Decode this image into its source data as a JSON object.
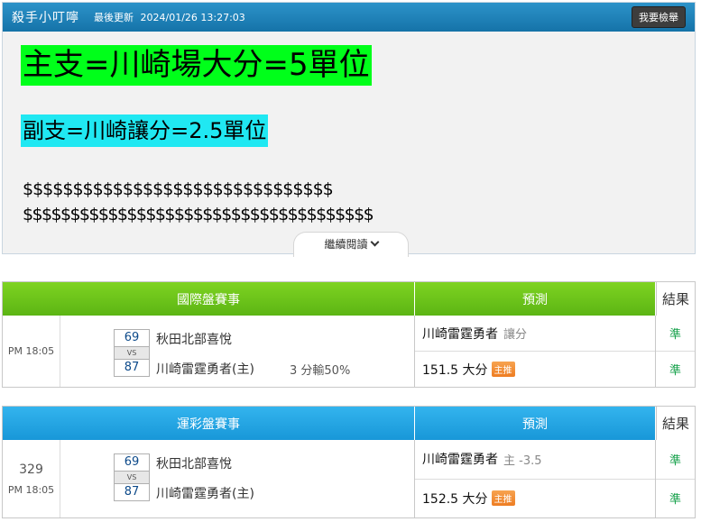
{
  "notice": {
    "title": "殺手小叮嚀",
    "updated_label": "最後更新",
    "updated_time": "2024/01/26 13:27:03",
    "button": "我要檢舉",
    "line1": "主支=川崎場大分=5單位",
    "line2": "副支=川崎讓分=2.5單位",
    "dollars1": "$$$$$$$$$$$$$$$$$$$$$$$$$$$$$$$",
    "dollars2": "$$$$$$$$$$$$$$$$$$$$$$$$$$$$$$$$$$$$$",
    "continue": "繼續閱讀",
    "colors": {
      "line1_bg": "#00ff1a",
      "line2_bg": "#20e8f2",
      "header": "#1f86bd"
    }
  },
  "intl": {
    "header": {
      "event": "國際盤賽事",
      "prediction": "預測",
      "result": "結果"
    },
    "time": "PM 18:05",
    "home": {
      "score": "69",
      "name": "秋田北部喜悅"
    },
    "vs": "VS",
    "away": {
      "score": "87",
      "name": "川崎雷霆勇者(主)"
    },
    "note": "3 分輸50%",
    "predictions": [
      {
        "main": "川崎雷霆勇者",
        "sub": "讓分",
        "badge": ""
      },
      {
        "main": "151.5 大分",
        "sub": "",
        "badge": "主推"
      }
    ],
    "results": [
      "準",
      "準"
    ]
  },
  "lottery": {
    "header": {
      "event": "運彩盤賽事",
      "prediction": "預測",
      "result": "結果"
    },
    "number": "329",
    "time": "PM 18:05",
    "home": {
      "score": "69",
      "name": "秋田北部喜悅"
    },
    "vs": "VS",
    "away": {
      "score": "87",
      "name": "川崎雷霆勇者(主)"
    },
    "predictions": [
      {
        "main": "川崎雷霆勇者",
        "sub": "主 -3.5",
        "badge": ""
      },
      {
        "main": "152.5 大分",
        "sub": "",
        "badge": "主推"
      }
    ],
    "results": [
      "準",
      "準"
    ]
  }
}
